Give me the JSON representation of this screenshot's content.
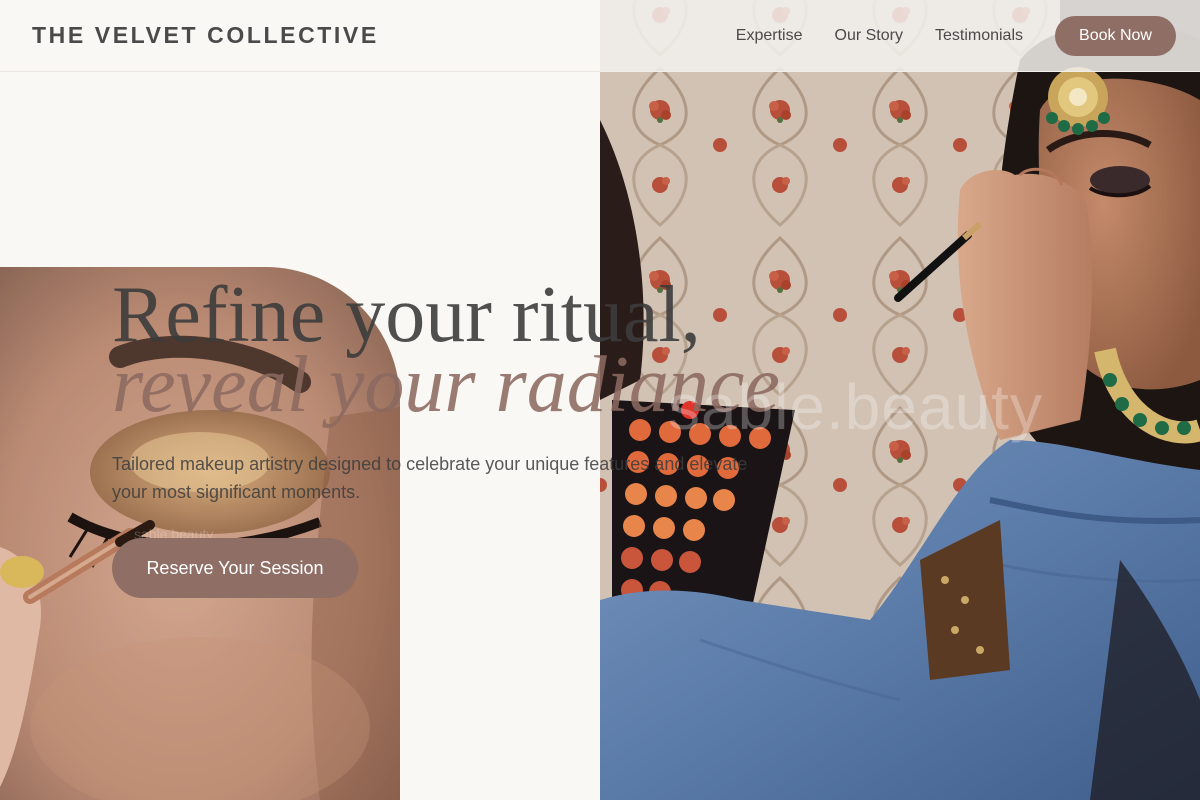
{
  "header": {
    "brand": "THE VELVET COLLECTIVE",
    "nav": [
      {
        "label": "Expertise"
      },
      {
        "label": "Our Story"
      },
      {
        "label": "Testimonials"
      }
    ],
    "book_label": "Book Now"
  },
  "hero": {
    "headline_line1": "Refine your ritual,",
    "headline_line2": "reveal your radiance",
    "subtext": "Tailored makeup artistry designed to celebrate your unique features and elevate your most significant moments.",
    "cta_label": "Reserve Your Session"
  },
  "watermark": {
    "large": "sable.beauty",
    "small": "sable.beauty"
  },
  "colors": {
    "background": "#faf8f4",
    "accent": "#8e6e65",
    "text": "#4a4a4a"
  },
  "images": {
    "left": "photo-eye-makeup-closeup",
    "right": "photo-bridal-makeup-application"
  }
}
